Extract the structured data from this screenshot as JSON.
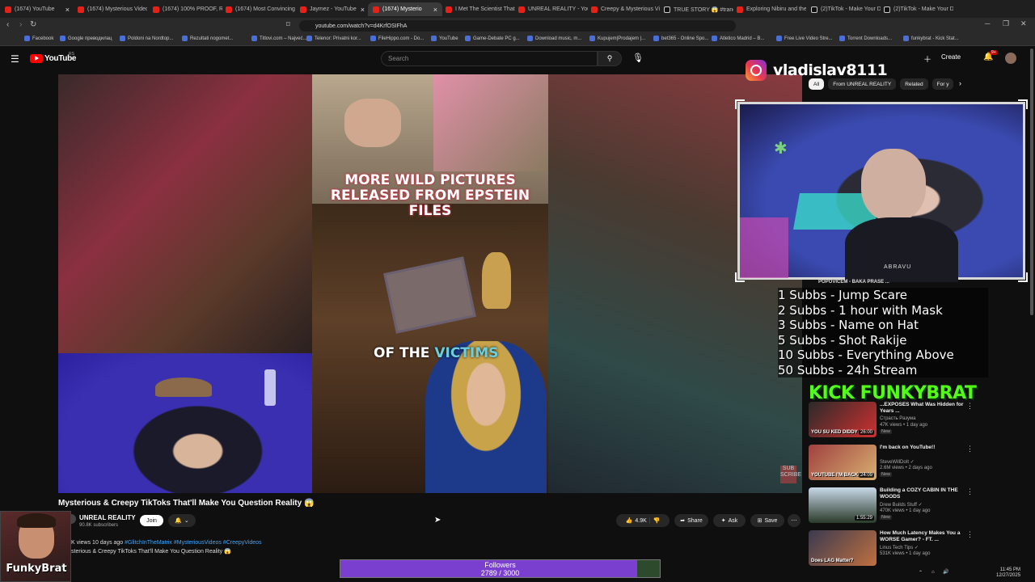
{
  "browser": {
    "tabs": [
      {
        "label": "(1674) YouTube",
        "kind": "yt"
      },
      {
        "label": "(1674) Mysterious Videos",
        "kind": "yt"
      },
      {
        "label": "(1674) 100% PROOF, R",
        "kind": "yt"
      },
      {
        "label": "(1674) Most Convincing",
        "kind": "yt"
      },
      {
        "label": "Jaymez - YouTube",
        "kind": "yt"
      },
      {
        "label": "(1674) Mysterio",
        "kind": "yt",
        "active": true
      },
      {
        "label": "I Met The Scientist That",
        "kind": "yt"
      },
      {
        "label": "UNREAL REALITY - YouT",
        "kind": "yt"
      },
      {
        "label": "Creepy & Mysterious Vi",
        "kind": "yt"
      },
      {
        "label": "TRUE STORY 😱 #tranc",
        "kind": "tt"
      },
      {
        "label": "Exploring Nibiru and the",
        "kind": "yt"
      },
      {
        "label": "(2)TikTok - Make Your D",
        "kind": "tt"
      },
      {
        "label": "(2)TikTok - Make Your D",
        "kind": "tt"
      }
    ],
    "url": "youtube.com/watch?v=d4KrfOSIFhA",
    "bookmarks": [
      "Facebook",
      "Google преводилац",
      "Poldoni na Nordtop...",
      "Rezultati nogomet...",
      "Titlovi.com – Najveć...",
      "Telenor: Privatni kor...",
      "FileHippo.com - Do...",
      "YouTube",
      "Game-Debate PC g...",
      "Download music, m...",
      "Kupujem|Prodajem |...",
      "bet365 - Online Spo...",
      "Atletico Madrid – B...",
      "Free Live Video Stre...",
      "Torrent Downloads...",
      "funkybrat - Kick Stat..."
    ]
  },
  "youtube": {
    "logo": "YouTube",
    "country": "RS",
    "search_placeholder": "Search",
    "create_label": "Create",
    "notif_count": "9+",
    "chips": [
      "All",
      "From UNREAL REALITY",
      "Related",
      "For y"
    ],
    "video": {
      "caption": "MORE WILD PICTURES RELEASED FROM EPSTEIN FILES",
      "caption_lower_a": "OF THE ",
      "caption_lower_b": "VICTIMS",
      "title": "Mysterious & Creepy TikToks That'll Make You Question Reality 😱",
      "channel": "UNREAL REALITY",
      "subs": "90.8K subscribers",
      "join": "Join",
      "likes": "4.9K",
      "share": "Share",
      "ask": "Ask",
      "save": "Save",
      "meta": "K views  10 days ago  ",
      "hashtags": "#GlitchInTheMatrix #MysteriousVideos #CreepyVideos",
      "desc_line": "sterious & Creepy TikToks That'll Make You Question Reality 😱",
      "subscribe_tag": "SUB SCRIBE"
    },
    "related": [
      {
        "title": "POPOVIĆEM - BAKA PRASE ...",
        "channel": "",
        "stats": "",
        "new": "",
        "dur": ""
      },
      {
        "title": "...EXPOSES What Was Hidden for Years ...",
        "channel": "Страсть Разума",
        "stats": "47K views • 1 day ago",
        "new": "New",
        "dur": "26:00",
        "thumb_text": "YOU SU KED DIDDY"
      },
      {
        "title": "I'm back on YouTube!!",
        "channel": "SteveWillDoIt ✓",
        "stats": "2.6M views • 2 days ago",
        "new": "New",
        "dur": "24:09",
        "thumb_text": "YOUTUBE I'M BACK ON"
      },
      {
        "title": "Building a COZY CABIN IN THE WOODS",
        "channel": "Drew Builds Stuff ✓",
        "stats": "470K views • 1 day ago",
        "new": "New",
        "dur": "1:55:29"
      },
      {
        "title": "How Much Latency Makes You a WORSE Gamer? - FT. ...",
        "channel": "Linus Tech Tips ✓",
        "stats": "531K views • 1 day ago",
        "new": "",
        "dur": "",
        "thumb_text": "Does LAG Matter?"
      }
    ]
  },
  "overlays": {
    "instagram_handle": "vladislav8111",
    "subs_goals": [
      "1 Subbs - Jump Scare",
      "2 Subbs - 1 hour with Mask",
      "3 Subbs - Name on Hat",
      "5 Subbs - Shot Rakije",
      "10 Subbs - Everything Above",
      "50 Subbs - 24h Stream"
    ],
    "kick_label": "KICK FUNKYBRAT",
    "streamer_label": "FunkyBrat",
    "followers": {
      "label": "Followers",
      "count": "2789 / 3000",
      "progress": 0.9297
    },
    "webcam_shirt": "ABRAVU"
  },
  "system": {
    "time": "11:45 PM",
    "date": "12/27/2025"
  },
  "colors": {
    "yt_red": "#ff0000",
    "kick_green": "#53fc18",
    "followers_purple": "#7b3fd0",
    "link_blue": "#3ea6ff"
  }
}
